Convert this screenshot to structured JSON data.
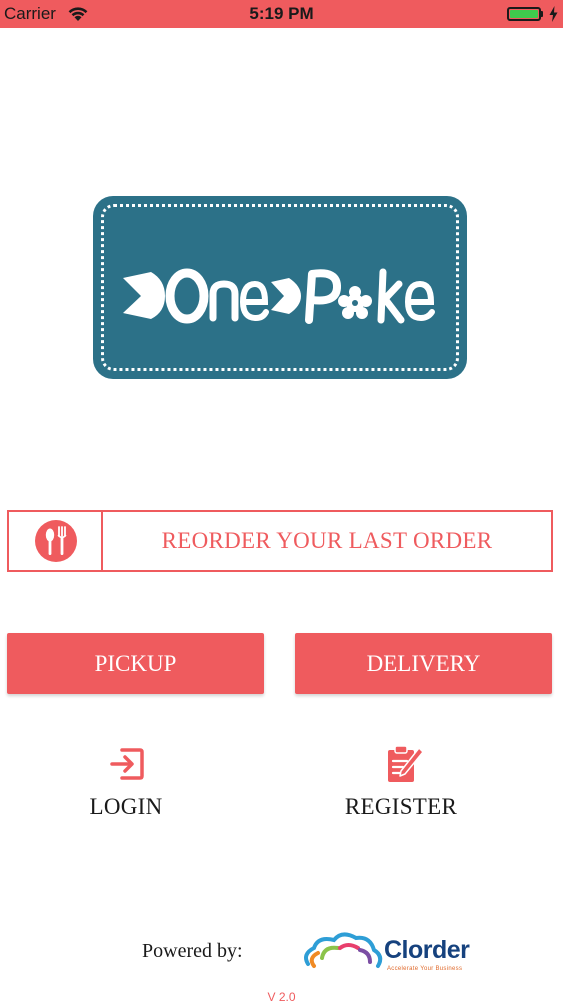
{
  "status_bar": {
    "carrier": "Carrier",
    "time": "5:19 PM",
    "bar_color": "#ef5b5e",
    "battery_color": "#3fcb4d"
  },
  "logo": {
    "text": "OnePoke",
    "background": "#2c7188"
  },
  "reorder": {
    "icon": "utensils-icon",
    "label": "REORDER YOUR LAST ORDER"
  },
  "actions": {
    "pickup_label": "PICKUP",
    "delivery_label": "DELIVERY",
    "accent": "#ef5b5e"
  },
  "auth": {
    "login_label": "LOGIN",
    "login_icon": "login-icon",
    "register_label": "REGISTER",
    "register_icon": "clipboard-icon"
  },
  "footer": {
    "powered_by": "Powered by:",
    "brand_name": "Clorder",
    "brand_tagline": "Accelerate Your Business",
    "version": "V 2.0"
  }
}
